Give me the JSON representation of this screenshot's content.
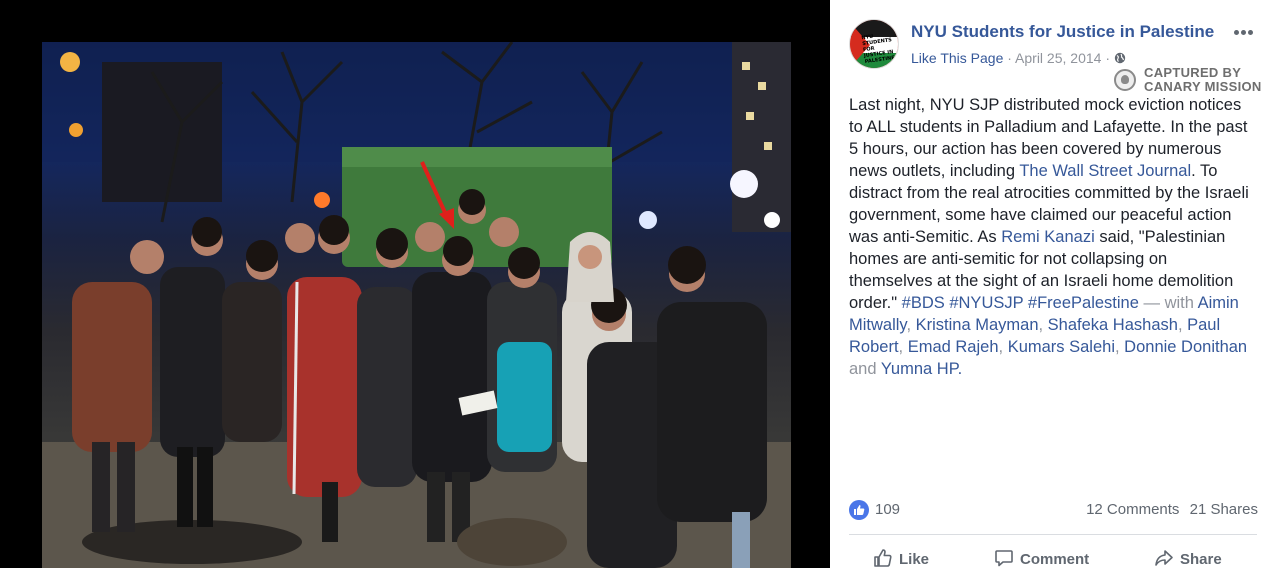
{
  "post": {
    "page_name": "NYU Students for Justice in Palestine",
    "like_page": "Like This Page",
    "sep1": " · ",
    "date": "April 25, 2014",
    "sep2": " · ",
    "avatar_text": "NYU STUDENTS FOR JUSTICE IN PALESTINE",
    "body_1": "Last night, NYU SJP distributed mock eviction notices to ALL students in Palladium and Lafayette. In the past 5 hours, our action has been covered by numerous news outlets, including ",
    "link_wsj": "The Wall Street Journal",
    "body_2": ". To distract from the real atrocities committed by the Israeli government, some have claimed our peaceful action was anti-Semitic. As ",
    "link_remi": "Remi Kanazi",
    "body_3": " said, \"Palestinian homes are anti-semitic for not collapsing on themselves at the sight of an Israeli home demolition order.\" ",
    "hashtags": [
      "#BDS",
      "#NYUSJP",
      "#FreePalestine"
    ],
    "with_text": " — with ",
    "tagged": [
      "Aimin Mitwally",
      "Kristina Mayman",
      "Shafeka Hashash",
      "Paul Robert",
      "Emad Rajeh",
      "Kumars Salehi",
      "Donnie Donithan",
      "Yumna HP"
    ],
    "comma": ", ",
    "and_text": " and ",
    "period": "."
  },
  "watermark": {
    "line1": "CAPTURED BY",
    "line2": "CANARY MISSION"
  },
  "stats": {
    "like_count": "109",
    "comments": "12 Comments",
    "shares": "21 Shares"
  },
  "actions": {
    "like": "Like",
    "comment": "Comment",
    "share": "Share"
  },
  "icons": {
    "more": "more-options-icon",
    "globe": "globe-icon",
    "like_badge": "thumbs-up-icon",
    "like_action": "thumbs-up-outline-icon",
    "comment_action": "comment-bubble-icon",
    "share_action": "share-arrow-icon",
    "annotation": "red-arrow-icon"
  },
  "colors": {
    "link": "#365899",
    "text": "#1d2129",
    "muted": "#90949c",
    "like_blue": "#4a76e8",
    "annotation_arrow": "#e0201b"
  }
}
